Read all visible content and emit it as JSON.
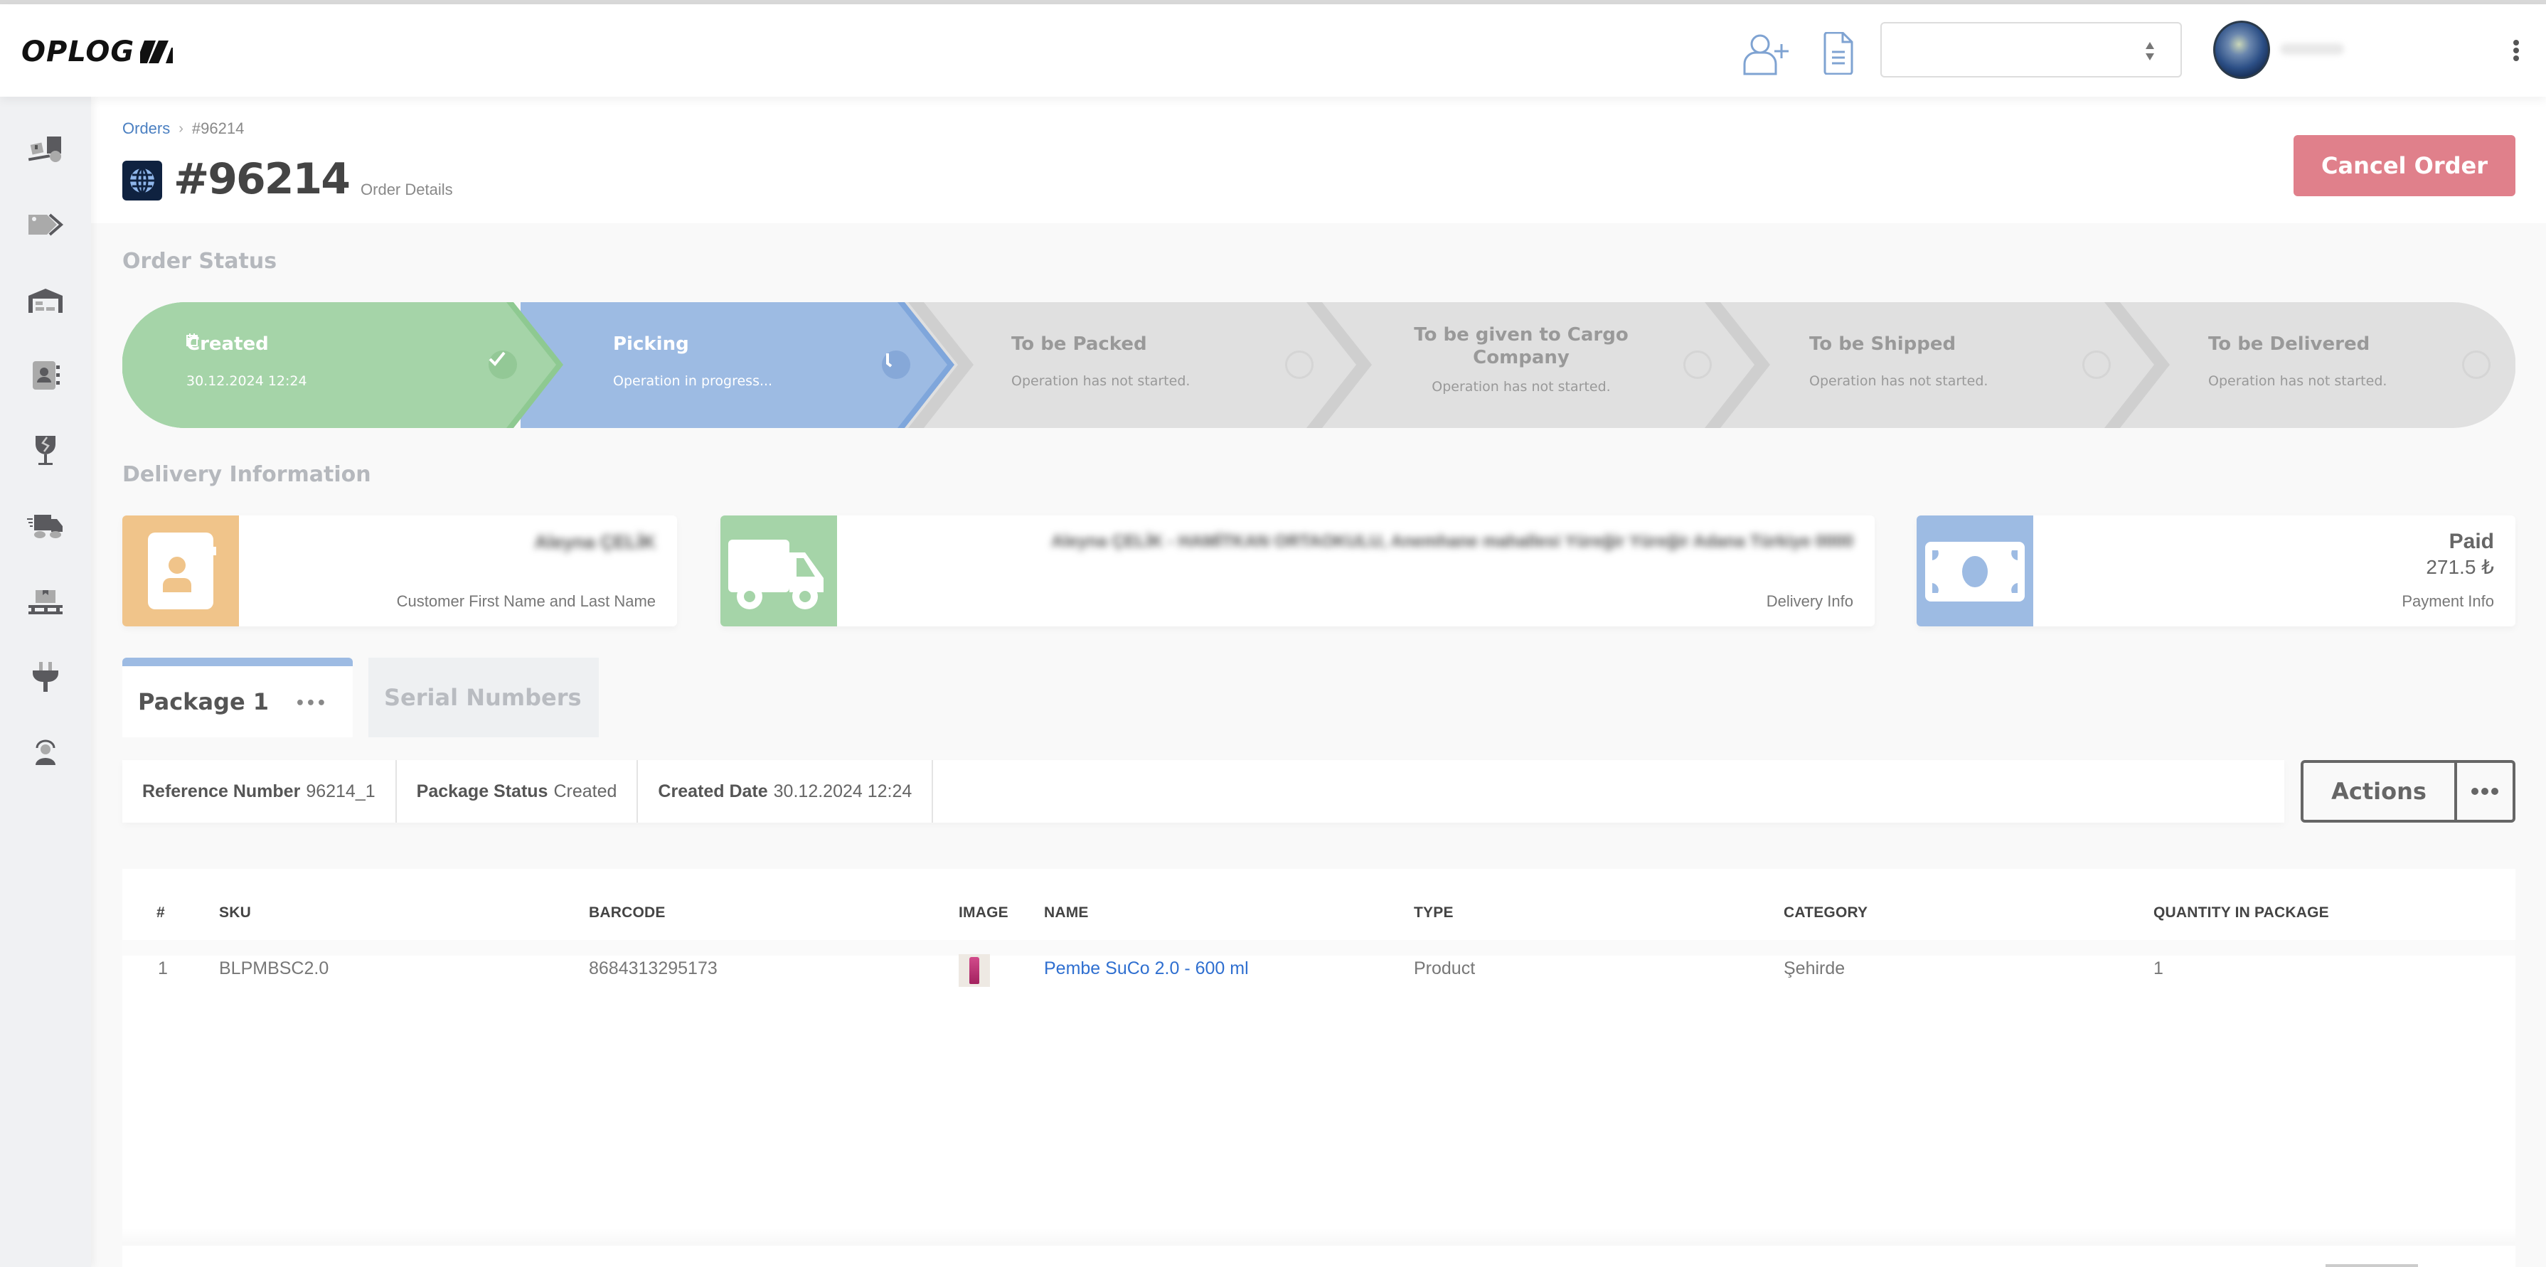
{
  "app": {
    "logo_text": "OPLOG",
    "brand_color": "#111111"
  },
  "topbar": {
    "add_user_icon": "user-plus-icon",
    "document_icon": "file-text-icon",
    "select_value": "",
    "avatar_icon": "earth-globe-avatar",
    "menu_icon": "kebab-vertical-icon"
  },
  "sidebar": {
    "items": [
      {
        "icon": "forklift-icon"
      },
      {
        "icon": "tags-icon"
      },
      {
        "icon": "warehouse-icon"
      },
      {
        "icon": "contacts-book-icon"
      },
      {
        "icon": "fragile-glass-icon"
      },
      {
        "icon": "fast-truck-icon"
      },
      {
        "icon": "pallet-box-icon"
      },
      {
        "icon": "plug-icon"
      },
      {
        "icon": "support-agent-icon"
      }
    ]
  },
  "breadcrumb": {
    "parent": "Orders",
    "separator": ">",
    "current": "#96214"
  },
  "header": {
    "order_icon": "globe-icon",
    "title": "#96214",
    "subtitle": "Order Details",
    "cancel_label": "Cancel Order",
    "cancel_color": "#e0808b"
  },
  "order_status": {
    "section_title": "Order Status",
    "steps": [
      {
        "title": "Created",
        "subtitle": "30.12.2024 12:24",
        "state": "done",
        "icon": "check-icon",
        "color": "#a5d4a8"
      },
      {
        "title": "Picking",
        "subtitle": "Operation in progress...",
        "state": "active",
        "icon": "clock-icon",
        "color": "#9dbbe3"
      },
      {
        "title": "To be Packed",
        "subtitle": "Operation has not started.",
        "state": "pending",
        "icon": "empty-circle-icon",
        "color": "#e0e0e0"
      },
      {
        "title": "To be given to Cargo Company",
        "subtitle": "Operation has not started.",
        "state": "pending",
        "icon": "empty-circle-icon",
        "color": "#e0e0e0"
      },
      {
        "title": "To be Shipped",
        "subtitle": "Operation has not started.",
        "state": "pending",
        "icon": "empty-circle-icon",
        "color": "#e0e0e0"
      },
      {
        "title": "To be Delivered",
        "subtitle": "Operation has not started.",
        "state": "pending",
        "icon": "empty-circle-icon",
        "color": "#e0e0e0"
      }
    ]
  },
  "delivery_info": {
    "section_title": "Delivery Information",
    "customer": {
      "value": "Aleyna ÇELİK",
      "caption": "Customer First Name and Last Name",
      "icon": "contact-card-icon",
      "color": "#f0c48a"
    },
    "delivery": {
      "value": "Aleyna ÇELİK - HAMİTKAN ORTAOKULU, Anemhane mahallesi Yüreğir Yüreğir Adana Türkiye 0000",
      "caption": "Delivery Info",
      "icon": "truck-icon",
      "color": "#a5d4a8"
    },
    "payment": {
      "status": "Paid",
      "amount": "271.5 ₺",
      "caption": "Payment Info",
      "icon": "money-bill-icon",
      "color": "#9dbbe3"
    }
  },
  "tabs": [
    {
      "label": "Package 1",
      "active": true,
      "more": "•••"
    },
    {
      "label": "Serial Numbers",
      "active": false
    }
  ],
  "package": {
    "reference_label": "Reference Number",
    "reference_value": "96214_1",
    "status_label": "Package Status",
    "status_value": "Created",
    "date_label": "Created Date",
    "date_value": "30.12.2024 12:24",
    "actions_label": "Actions"
  },
  "table": {
    "columns": [
      "#",
      "SKU",
      "BARCODE",
      "IMAGE",
      "NAME",
      "TYPE",
      "CATEGORY",
      "QUANTITY IN PACKAGE"
    ],
    "rows": [
      {
        "index": "1",
        "sku": "BLPMBSC2.0",
        "barcode": "8684313295173",
        "image": "product-thumbnail",
        "name": "Pembe SuCo 2.0 - 600 ml",
        "type": "Product",
        "category": "Şehirde",
        "quantity": "1"
      }
    ]
  }
}
